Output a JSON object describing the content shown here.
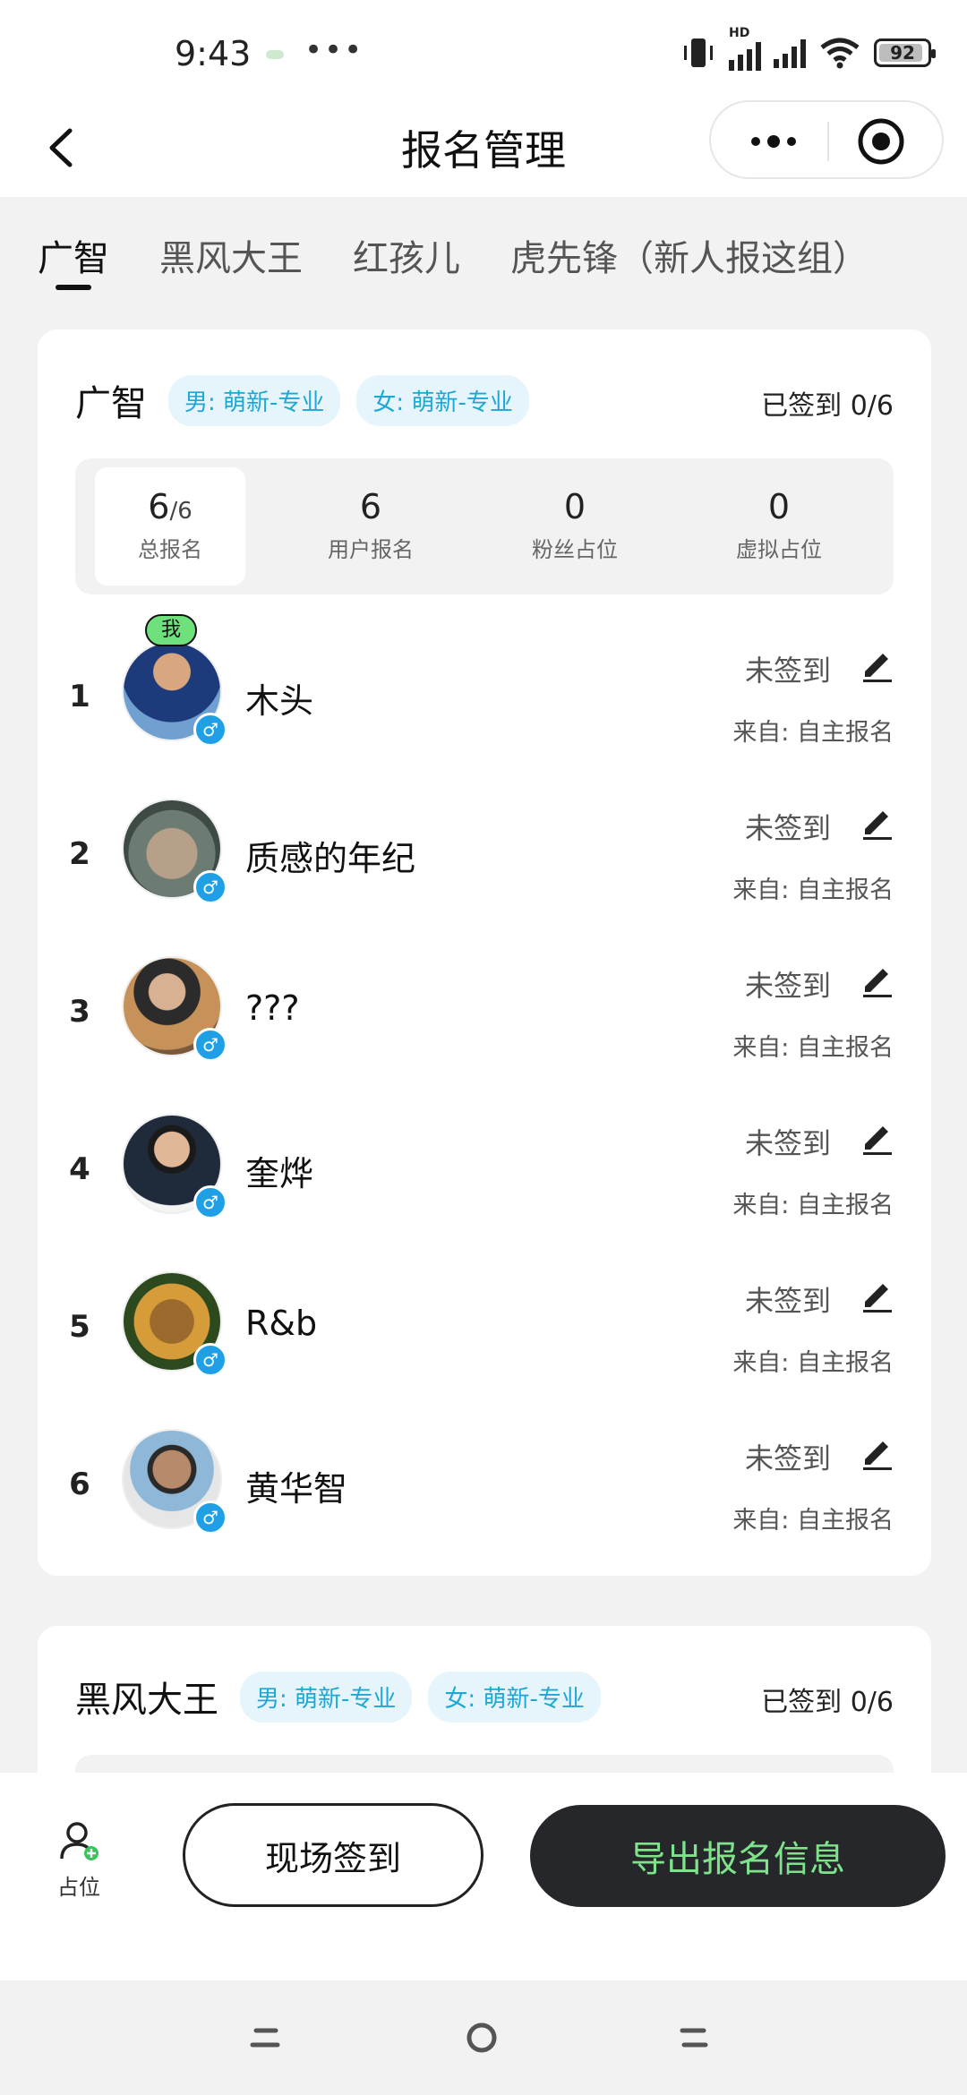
{
  "status_bar": {
    "time": "9:43",
    "dots": "•••",
    "hd": "HD",
    "battery": "92",
    "battery_level": 0.92
  },
  "nav": {
    "title": "报名管理"
  },
  "tabs": [
    {
      "label": "广智",
      "active": true
    },
    {
      "label": "黑风大王",
      "active": false
    },
    {
      "label": "红孩儿",
      "active": false
    },
    {
      "label": "虎先锋（新人报这组）",
      "active": false
    }
  ],
  "groups": [
    {
      "name": "广智",
      "tag_male": "男: 萌新-专业",
      "tag_female": "女: 萌新-专业",
      "signed": "已签到 0/6",
      "stats": {
        "total_value": "6",
        "total_max": "/6",
        "total_label": "总报名",
        "user_value": "6",
        "user_label": "用户报名",
        "fans_value": "0",
        "fans_label": "粉丝占位",
        "virtual_value": "0",
        "virtual_label": "虚拟占位"
      },
      "members": [
        {
          "index": "1",
          "name": "木头",
          "status": "未签到",
          "source": "来自: 自主报名",
          "me_badge": "我",
          "gender": "♂"
        },
        {
          "index": "2",
          "name": "质感的年纪",
          "status": "未签到",
          "source": "来自: 自主报名",
          "gender": "♂"
        },
        {
          "index": "3",
          "name": "???",
          "status": "未签到",
          "source": "来自: 自主报名",
          "gender": "♂"
        },
        {
          "index": "4",
          "name": "奎烨",
          "status": "未签到",
          "source": "来自: 自主报名",
          "gender": "♂"
        },
        {
          "index": "5",
          "name": "R&b",
          "status": "未签到",
          "source": "来自: 自主报名",
          "gender": "♂"
        },
        {
          "index": "6",
          "name": "黄华智",
          "status": "未签到",
          "source": "来自: 自主报名",
          "gender": "♂"
        }
      ]
    },
    {
      "name": "黑风大王",
      "tag_male": "男: 萌新-专业",
      "tag_female": "女: 萌新-专业",
      "signed": "已签到 0/6"
    }
  ],
  "bottom": {
    "occupy_label": "占位",
    "checkin_label": "现场签到",
    "export_label": "导出报名信息"
  },
  "colors": {
    "accent_green": "#7ee38b",
    "tag_blue": "#1ea7d6",
    "gender_blue": "#1ea0e6",
    "dark_button": "#26272b"
  }
}
